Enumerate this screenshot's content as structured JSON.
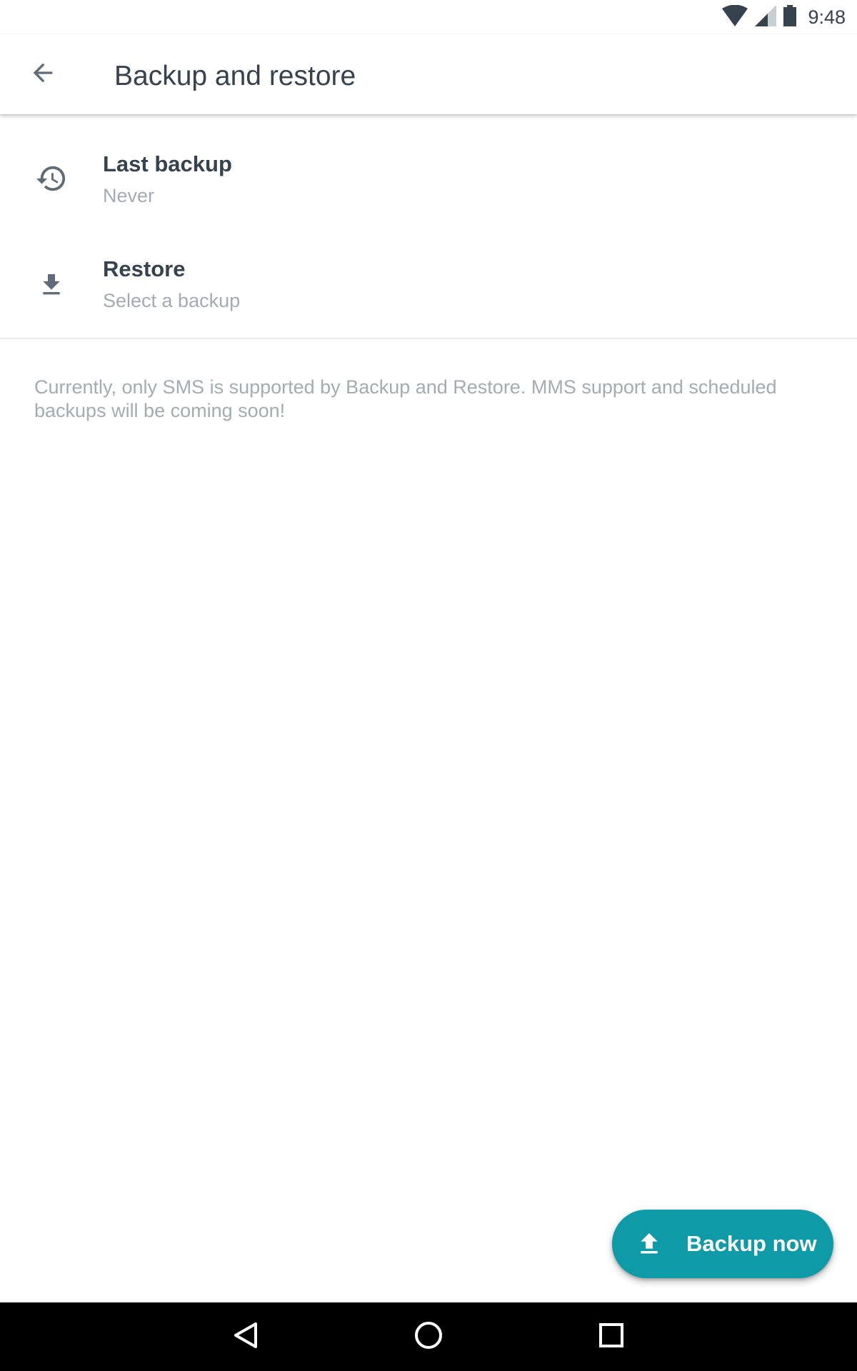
{
  "status_bar": {
    "time": "9:48",
    "icons": [
      "wifi-icon",
      "cellular-signal-icon",
      "battery-icon"
    ]
  },
  "app_bar": {
    "title": "Backup and restore",
    "back_icon": "arrow-back-icon"
  },
  "preferences": [
    {
      "icon": "history-icon",
      "title": "Last backup",
      "summary": "Never"
    },
    {
      "icon": "download-icon",
      "title": "Restore",
      "summary": "Select a backup"
    }
  ],
  "info_text": "Currently, only SMS is supported by Backup and Restore. MMS support and scheduled backups will be coming soon!",
  "fab": {
    "label": "Backup now",
    "icon": "upload-icon"
  },
  "nav_bar": {
    "buttons": [
      "back-nav-icon",
      "home-nav-icon",
      "recents-nav-icon"
    ]
  },
  "colors": {
    "accent": "#0e9aa7",
    "text_primary": "#37424f",
    "text_secondary": "#a4abb3",
    "background": "#ffffff",
    "nav_bar": "#000000"
  }
}
